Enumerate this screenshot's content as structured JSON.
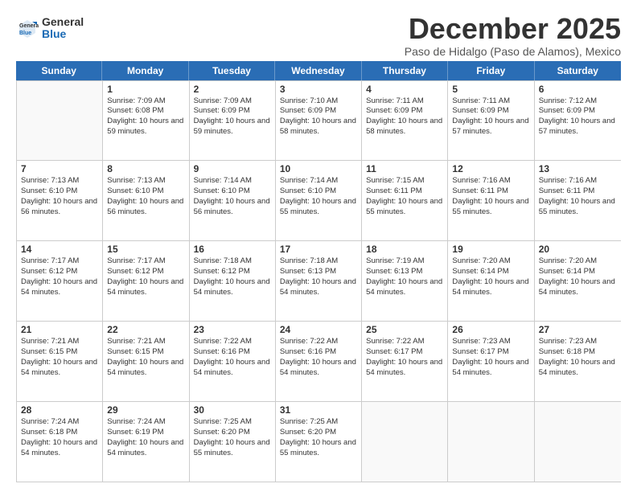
{
  "logo": {
    "general": "General",
    "blue": "Blue"
  },
  "title": "December 2025",
  "location": "Paso de Hidalgo (Paso de Alamos), Mexico",
  "header_days": [
    "Sunday",
    "Monday",
    "Tuesday",
    "Wednesday",
    "Thursday",
    "Friday",
    "Saturday"
  ],
  "weeks": [
    [
      {
        "day": "",
        "sunrise": "",
        "sunset": "",
        "daylight": ""
      },
      {
        "day": "1",
        "sunrise": "Sunrise: 7:09 AM",
        "sunset": "Sunset: 6:08 PM",
        "daylight": "Daylight: 10 hours and 59 minutes."
      },
      {
        "day": "2",
        "sunrise": "Sunrise: 7:09 AM",
        "sunset": "Sunset: 6:09 PM",
        "daylight": "Daylight: 10 hours and 59 minutes."
      },
      {
        "day": "3",
        "sunrise": "Sunrise: 7:10 AM",
        "sunset": "Sunset: 6:09 PM",
        "daylight": "Daylight: 10 hours and 58 minutes."
      },
      {
        "day": "4",
        "sunrise": "Sunrise: 7:11 AM",
        "sunset": "Sunset: 6:09 PM",
        "daylight": "Daylight: 10 hours and 58 minutes."
      },
      {
        "day": "5",
        "sunrise": "Sunrise: 7:11 AM",
        "sunset": "Sunset: 6:09 PM",
        "daylight": "Daylight: 10 hours and 57 minutes."
      },
      {
        "day": "6",
        "sunrise": "Sunrise: 7:12 AM",
        "sunset": "Sunset: 6:09 PM",
        "daylight": "Daylight: 10 hours and 57 minutes."
      }
    ],
    [
      {
        "day": "7",
        "sunrise": "Sunrise: 7:13 AM",
        "sunset": "Sunset: 6:10 PM",
        "daylight": "Daylight: 10 hours and 56 minutes."
      },
      {
        "day": "8",
        "sunrise": "Sunrise: 7:13 AM",
        "sunset": "Sunset: 6:10 PM",
        "daylight": "Daylight: 10 hours and 56 minutes."
      },
      {
        "day": "9",
        "sunrise": "Sunrise: 7:14 AM",
        "sunset": "Sunset: 6:10 PM",
        "daylight": "Daylight: 10 hours and 56 minutes."
      },
      {
        "day": "10",
        "sunrise": "Sunrise: 7:14 AM",
        "sunset": "Sunset: 6:10 PM",
        "daylight": "Daylight: 10 hours and 55 minutes."
      },
      {
        "day": "11",
        "sunrise": "Sunrise: 7:15 AM",
        "sunset": "Sunset: 6:11 PM",
        "daylight": "Daylight: 10 hours and 55 minutes."
      },
      {
        "day": "12",
        "sunrise": "Sunrise: 7:16 AM",
        "sunset": "Sunset: 6:11 PM",
        "daylight": "Daylight: 10 hours and 55 minutes."
      },
      {
        "day": "13",
        "sunrise": "Sunrise: 7:16 AM",
        "sunset": "Sunset: 6:11 PM",
        "daylight": "Daylight: 10 hours and 55 minutes."
      }
    ],
    [
      {
        "day": "14",
        "sunrise": "Sunrise: 7:17 AM",
        "sunset": "Sunset: 6:12 PM",
        "daylight": "Daylight: 10 hours and 54 minutes."
      },
      {
        "day": "15",
        "sunrise": "Sunrise: 7:17 AM",
        "sunset": "Sunset: 6:12 PM",
        "daylight": "Daylight: 10 hours and 54 minutes."
      },
      {
        "day": "16",
        "sunrise": "Sunrise: 7:18 AM",
        "sunset": "Sunset: 6:12 PM",
        "daylight": "Daylight: 10 hours and 54 minutes."
      },
      {
        "day": "17",
        "sunrise": "Sunrise: 7:18 AM",
        "sunset": "Sunset: 6:13 PM",
        "daylight": "Daylight: 10 hours and 54 minutes."
      },
      {
        "day": "18",
        "sunrise": "Sunrise: 7:19 AM",
        "sunset": "Sunset: 6:13 PM",
        "daylight": "Daylight: 10 hours and 54 minutes."
      },
      {
        "day": "19",
        "sunrise": "Sunrise: 7:20 AM",
        "sunset": "Sunset: 6:14 PM",
        "daylight": "Daylight: 10 hours and 54 minutes."
      },
      {
        "day": "20",
        "sunrise": "Sunrise: 7:20 AM",
        "sunset": "Sunset: 6:14 PM",
        "daylight": "Daylight: 10 hours and 54 minutes."
      }
    ],
    [
      {
        "day": "21",
        "sunrise": "Sunrise: 7:21 AM",
        "sunset": "Sunset: 6:15 PM",
        "daylight": "Daylight: 10 hours and 54 minutes."
      },
      {
        "day": "22",
        "sunrise": "Sunrise: 7:21 AM",
        "sunset": "Sunset: 6:15 PM",
        "daylight": "Daylight: 10 hours and 54 minutes."
      },
      {
        "day": "23",
        "sunrise": "Sunrise: 7:22 AM",
        "sunset": "Sunset: 6:16 PM",
        "daylight": "Daylight: 10 hours and 54 minutes."
      },
      {
        "day": "24",
        "sunrise": "Sunrise: 7:22 AM",
        "sunset": "Sunset: 6:16 PM",
        "daylight": "Daylight: 10 hours and 54 minutes."
      },
      {
        "day": "25",
        "sunrise": "Sunrise: 7:22 AM",
        "sunset": "Sunset: 6:17 PM",
        "daylight": "Daylight: 10 hours and 54 minutes."
      },
      {
        "day": "26",
        "sunrise": "Sunrise: 7:23 AM",
        "sunset": "Sunset: 6:17 PM",
        "daylight": "Daylight: 10 hours and 54 minutes."
      },
      {
        "day": "27",
        "sunrise": "Sunrise: 7:23 AM",
        "sunset": "Sunset: 6:18 PM",
        "daylight": "Daylight: 10 hours and 54 minutes."
      }
    ],
    [
      {
        "day": "28",
        "sunrise": "Sunrise: 7:24 AM",
        "sunset": "Sunset: 6:18 PM",
        "daylight": "Daylight: 10 hours and 54 minutes."
      },
      {
        "day": "29",
        "sunrise": "Sunrise: 7:24 AM",
        "sunset": "Sunset: 6:19 PM",
        "daylight": "Daylight: 10 hours and 54 minutes."
      },
      {
        "day": "30",
        "sunrise": "Sunrise: 7:25 AM",
        "sunset": "Sunset: 6:20 PM",
        "daylight": "Daylight: 10 hours and 55 minutes."
      },
      {
        "day": "31",
        "sunrise": "Sunrise: 7:25 AM",
        "sunset": "Sunset: 6:20 PM",
        "daylight": "Daylight: 10 hours and 55 minutes."
      },
      {
        "day": "",
        "sunrise": "",
        "sunset": "",
        "daylight": ""
      },
      {
        "day": "",
        "sunrise": "",
        "sunset": "",
        "daylight": ""
      },
      {
        "day": "",
        "sunrise": "",
        "sunset": "",
        "daylight": ""
      }
    ]
  ]
}
